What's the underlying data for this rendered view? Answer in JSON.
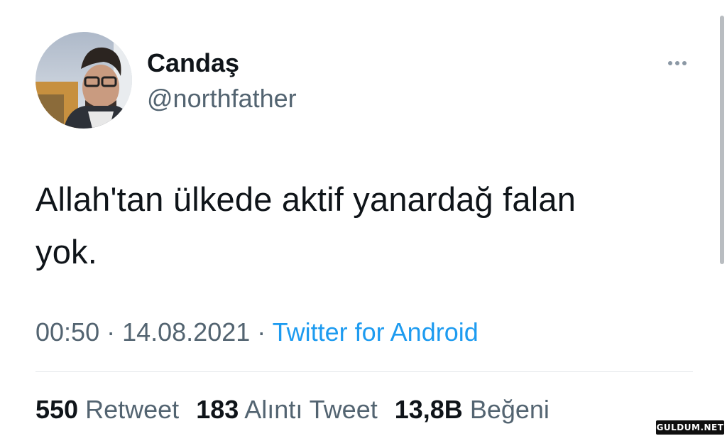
{
  "user": {
    "display_name": "Candaş",
    "handle": "@northfather"
  },
  "tweet": {
    "text_line1": "Allah'tan ülkede aktif yanardağ falan",
    "text_line2": "yok."
  },
  "meta": {
    "time": "00:50",
    "separator": " · ",
    "date": "14.08.2021",
    "source": "Twitter for Android"
  },
  "stats": {
    "retweets_count": "550",
    "retweets_label": "Retweet",
    "quotes_count": "183",
    "quotes_label": "Alıntı Tweet",
    "likes_count": "13,8B",
    "likes_label": "Beğeni"
  },
  "watermark": {
    "text": "GULDUM.NET"
  },
  "colors": {
    "text_primary": "#0f1419",
    "text_secondary": "#536471",
    "link": "#1d9bf0",
    "divider": "#e6e9eb"
  },
  "icons": {
    "more": "more-horizontal-icon"
  }
}
